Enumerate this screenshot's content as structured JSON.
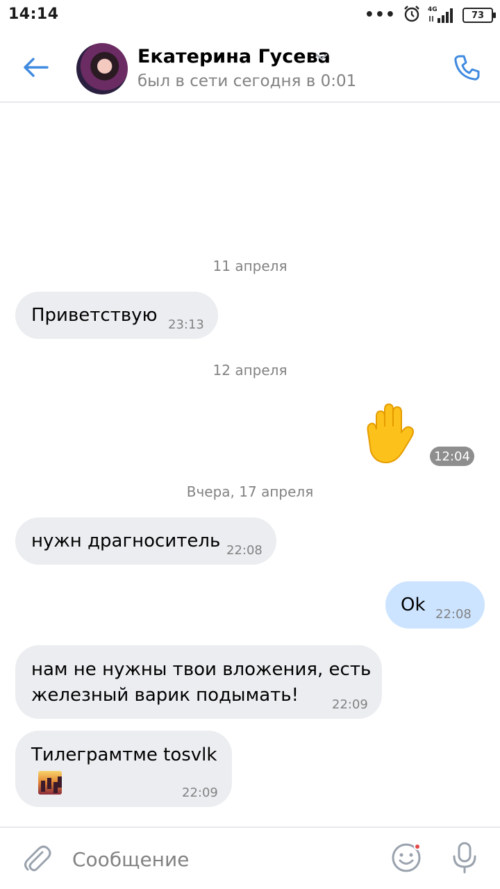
{
  "status_bar": {
    "time": "14:14",
    "network": "4G",
    "battery": "73"
  },
  "header": {
    "contact_name": "Екатерина Гусева",
    "contact_status": "был в сети сегодня в 0:01",
    "accent_color": "#3f8ae0"
  },
  "chat": {
    "date_1": "11 апреля",
    "date_2": "12 апреля",
    "date_3": "Вчера, 17 апреля",
    "messages": [
      {
        "direction": "in",
        "text": "Приветствую",
        "time": "23:13"
      },
      {
        "direction": "out",
        "sticker": "raised-hand-emoji",
        "time": "12:04"
      },
      {
        "direction": "in",
        "text": "нужн драгноситель",
        "time": "22:08"
      },
      {
        "direction": "out",
        "text": "Ok",
        "time": "22:08"
      },
      {
        "direction": "in",
        "text_line1": "нам не нужны твои вложения, есть",
        "text_line2": "железный варик подымать!",
        "time": "22:09"
      },
      {
        "direction": "in",
        "text": "Тилеграмтме tosvlk",
        "emoji": "city-sunset-emoji",
        "time": "22:09"
      }
    ]
  },
  "composer": {
    "placeholder": "Сообщение"
  }
}
